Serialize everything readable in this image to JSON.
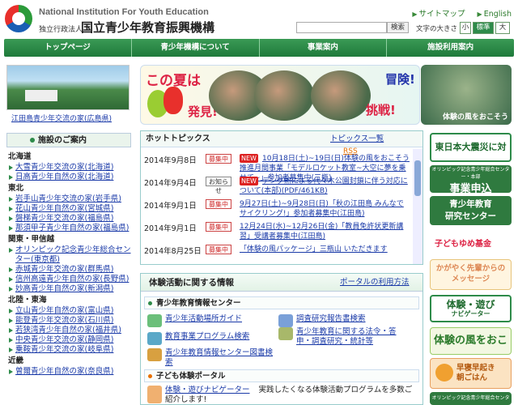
{
  "header": {
    "org_en": "National Institution For Youth Education",
    "org_sub": "独立行政法人",
    "org_jp": "国立青少年教育振興機構",
    "sitemap": "サイトマップ",
    "english": "English",
    "search_button": "検索",
    "search_placeholder": "",
    "font_size_label": "文字の大きさ",
    "font_small": "小",
    "font_medium": "標準",
    "font_large": "大"
  },
  "nav": [
    "トップページ",
    "青少年機構について",
    "事業案内",
    "施設利用案内"
  ],
  "left": {
    "photo_caption": "江田島青少年交流の家(広島県)",
    "section_title": "施設のご案内",
    "regions": [
      {
        "name": "北海道",
        "items": [
          "大雪青少年交流の家(北海道)",
          "日高青少年自然の家(北海道)"
        ]
      },
      {
        "name": "東北",
        "items": [
          "岩手山青少年交流の家(岩手県)",
          "花山青少年自然の家(宮城県)",
          "磐梯青少年交流の家(福島県)",
          "那須甲子青少年自然の家(福島県)"
        ]
      },
      {
        "name": "関東・甲信越",
        "items": [
          "オリンピック記念青少年総合センター(東京都)",
          "赤城青少年交流の家(群馬県)",
          "信州高遠青少年自然の家(長野県)",
          "妙高青少年自然の家(新潟県)"
        ]
      },
      {
        "name": "北陸・東海",
        "items": [
          "立山青少年自然の家(富山県)",
          "能登青少年交流の家(石川県)",
          "若狭湾青少年自然の家(福井県)",
          "中央青少年交流の家(静岡県)",
          "乗鞍青少年交流の家(岐阜県)"
        ]
      },
      {
        "name": "近畿",
        "items": [
          "曽爾青少年自然の家(奈良県)"
        ]
      }
    ]
  },
  "banner": {
    "t1": "この夏は",
    "t2": "発見!",
    "t3": "冒険!",
    "t4": "挑戦!",
    "right_text": "体験の風をおこそう"
  },
  "topics": {
    "title": "ホットトピックス",
    "list_link": "トピックス一覧",
    "rss": "RSS",
    "items": [
      {
        "date": "2014年9月8日",
        "badge": "募集中",
        "new": "NEW",
        "text": "10月18日(土)~19日(日)体験の風をおこそう推進月間事業「モデルロケット教室~大空に夢を乗せて~」参加者募集中(三瓶)"
      },
      {
        "date": "2014年9月4日",
        "badge": "お知らせ",
        "new": "NEW",
        "text": "デング熱による代々木公園封鎖に伴う対応について(本部)(PDF/461KB)"
      },
      {
        "date": "2014年9月1日",
        "badge": "募集中",
        "new": "",
        "text": "9月27日(土)~9月28日(日)「秋の江田島 みんなでサイクリング!」参加者募集中(江田島)"
      },
      {
        "date": "2014年9月1日",
        "badge": "募集中",
        "new": "",
        "text": "12月24日(水)~12月26日(金)「教員免許状更新講習」受講者募集中(江田島)"
      },
      {
        "date": "2014年8月25日",
        "badge": "募集中",
        "new": "",
        "text": "「体験の風パッケージ」三瓶山 いただきます"
      }
    ]
  },
  "experience": {
    "title": "体験活動に関する情報",
    "portal_link": "ポータルの利用方法",
    "sub1": "青少年教育情報センター",
    "items1": [
      "青少年活動場所ガイド",
      "調査研究報告書検索",
      "教育事業プログラム検索",
      "青少年教育に関する法令・答申・調査研究・統計等",
      "青少年教育情報センター図書検索"
    ],
    "sub2": "子ども体験ポータル",
    "item2_link": "体験・遊びナビゲーター",
    "item2_text": "実践したくなる体験活動プログラムを多数ご紹介します!"
  },
  "right": {
    "r1": "東日本大震災に対する取組",
    "r2_small": "オリンピック記念青少年総合センター・本部",
    "r2": "事業申込",
    "r3a": "青少年教育",
    "r3b": "研究センター",
    "r4": "子どもゆめ基金",
    "r5a": "かがやく先輩からの",
    "r5b": "メッセージ",
    "r6": "体験・遊び",
    "r6s": "ナビゲーター",
    "r7": "体験の風をおこそう",
    "r8a": "早寝早起き",
    "r8b": "朝ごはん",
    "r9": "オリンピック記念青少年総合センター"
  },
  "colors": {
    "primary_green": "#2e8b4a",
    "link_blue": "#1a3aa8",
    "accent_red": "#d22"
  }
}
